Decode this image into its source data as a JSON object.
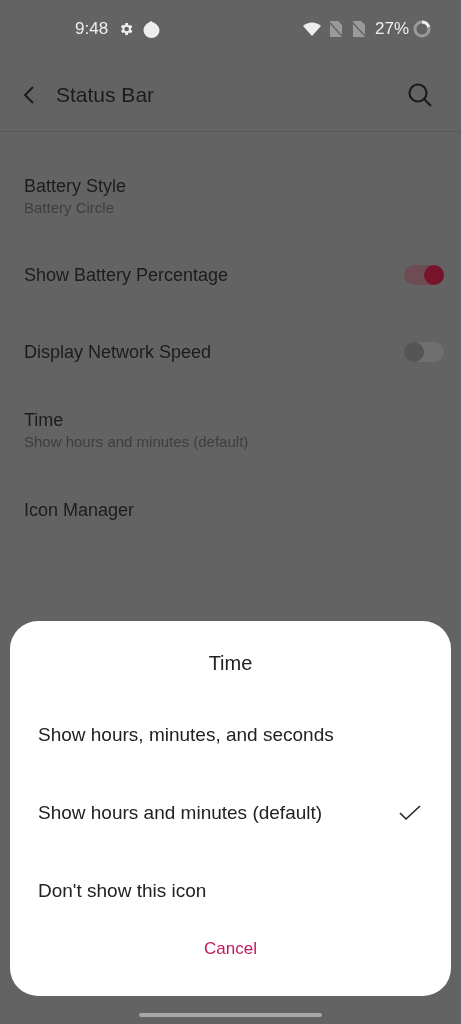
{
  "status_bar": {
    "time": "9:48",
    "battery": "27%"
  },
  "header": {
    "title": "Status Bar"
  },
  "settings": [
    {
      "kind": "nav",
      "title": "Battery Style",
      "subtitle": "Battery Circle"
    },
    {
      "kind": "toggle",
      "title": "Show Battery Percentage",
      "on": true
    },
    {
      "kind": "toggle",
      "title": "Display Network Speed",
      "on": false
    },
    {
      "kind": "nav",
      "title": "Time",
      "subtitle": "Show hours and minutes (default)"
    },
    {
      "kind": "nav",
      "title": "Icon Manager"
    }
  ],
  "dialog": {
    "title": "Time",
    "options": [
      {
        "label": "Show hours, minutes, and seconds",
        "selected": false
      },
      {
        "label": "Show hours and minutes (default)",
        "selected": true
      },
      {
        "label": "Don't show this icon",
        "selected": false
      }
    ],
    "cancel": "Cancel"
  }
}
